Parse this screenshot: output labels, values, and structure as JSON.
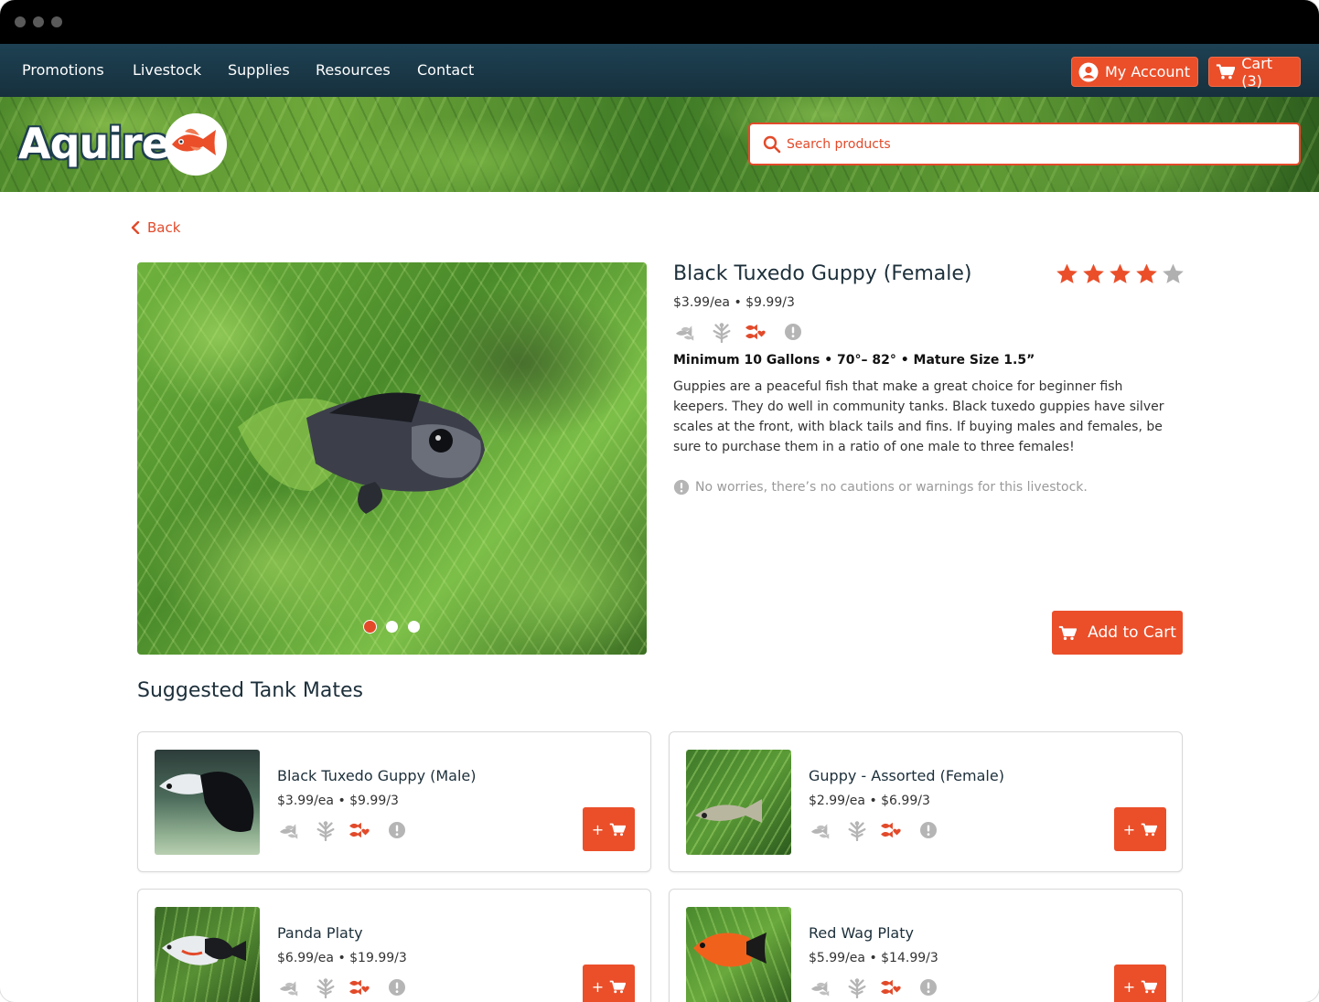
{
  "nav": {
    "links": [
      "Promotions",
      "Livestock",
      "Supplies",
      "Resources",
      "Contact"
    ],
    "account_label": "My Account",
    "cart_label": "Cart (3)"
  },
  "brand": {
    "logo_text": "Aquire"
  },
  "search": {
    "placeholder": "Search products"
  },
  "back_label": "Back",
  "product": {
    "title": "Black Tuxedo Guppy (Female)",
    "rating": 4,
    "rating_max": 5,
    "price": "$3.99/ea • $9.99/3",
    "specs": "Minimum 10 Gallons • 70°– 82° • Mature Size 1.5”",
    "description": "Guppies are a peaceful fish that make a great choice for beginner fish keepers. They do well in community tanks. Black tuxedo guppies have silver scales at the front, with black tails and fins. If buying males and females, be sure to purchase them in a ratio of one male to three females!",
    "caution": "No worries, there’s no cautions or warnings for this livestock.",
    "add_to_cart": "Add to Cart",
    "carousel_active": 1,
    "carousel_count": 3
  },
  "suggested": {
    "title": "Suggested Tank Mates",
    "items": [
      {
        "name": "Black Tuxedo Guppy (Male)",
        "price": "$3.99/ea • $9.99/3"
      },
      {
        "name": "Guppy - Assorted (Female)",
        "price": "$2.99/ea • $6.99/3"
      },
      {
        "name": "Panda Platy",
        "price": "$6.99/ea • $19.99/3"
      },
      {
        "name": "Red Wag Platy",
        "price": "$5.99/ea • $14.99/3"
      }
    ],
    "add_label": "+"
  },
  "colors": {
    "accent": "#ea4f2a",
    "nav": "#1d4153",
    "icon_grey": "#b5b5b5",
    "star_off": "#b0b0b0"
  },
  "icons": [
    "school-fish-icon",
    "plant-icon",
    "fish-heart-icon",
    "info-icon",
    "cart-icon",
    "user-icon",
    "search-icon",
    "chevron-left-icon",
    "star-icon"
  ]
}
